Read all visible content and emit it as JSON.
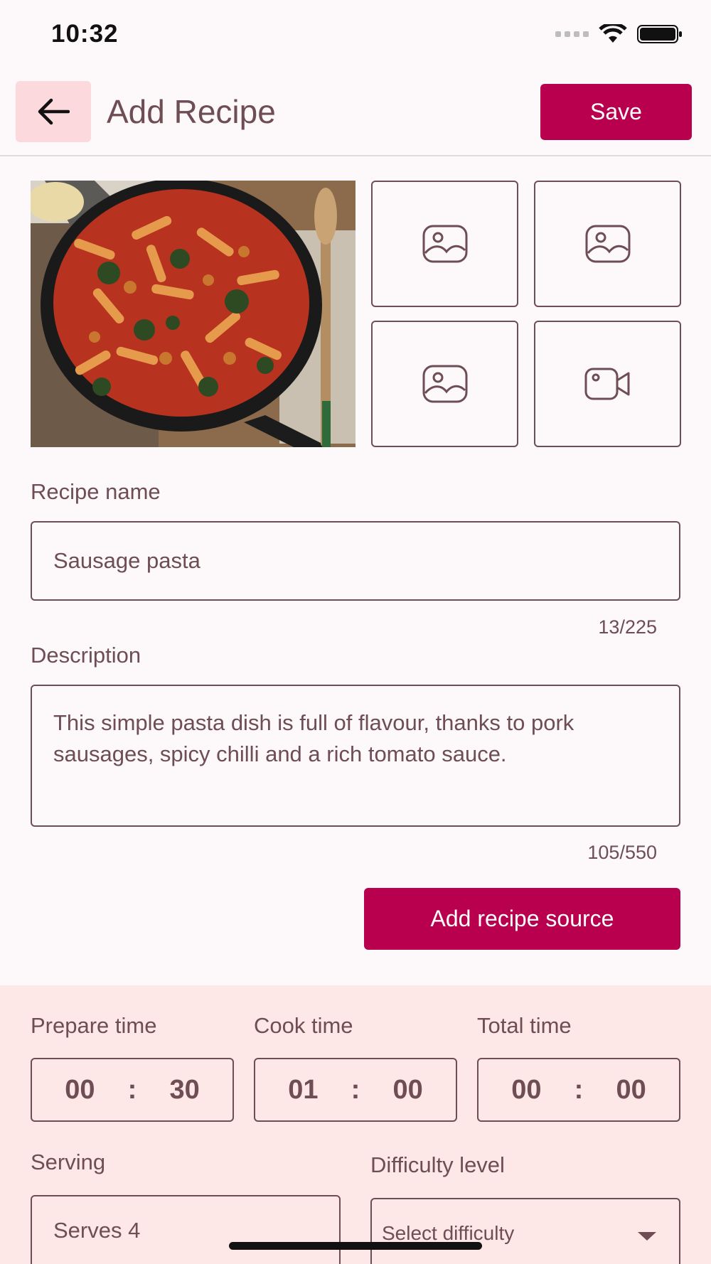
{
  "status_bar": {
    "time": "10:32",
    "icons": [
      "signal-icon",
      "wifi-icon",
      "battery-icon"
    ]
  },
  "app_bar": {
    "title": "Add Recipe",
    "save_label": "Save",
    "back_icon": "arrow-left-icon"
  },
  "media": {
    "main_photo_alt": "Sausage pasta in a cast-iron skillet",
    "slots": [
      {
        "icon": "image-icon"
      },
      {
        "icon": "image-icon"
      },
      {
        "icon": "image-icon"
      },
      {
        "icon": "video-camera-icon"
      }
    ]
  },
  "recipe_name": {
    "label": "Recipe name",
    "value": "Sausage pasta",
    "counter": "13/225"
  },
  "description": {
    "label": "Description",
    "value": "This simple pasta dish is full of flavour, thanks to pork sausages, spicy chilli and a rich tomato sauce.",
    "counter": "105/550"
  },
  "add_source_label": "Add recipe source",
  "times": {
    "prepare": {
      "label": "Prepare time",
      "hours": "00",
      "minutes": "30",
      "separator": ":"
    },
    "cook": {
      "label": "Cook time",
      "hours": "01",
      "minutes": "00",
      "separator": ":"
    },
    "total": {
      "label": "Total time",
      "hours": "00",
      "minutes": "00",
      "separator": ":"
    }
  },
  "serving": {
    "label": "Serving",
    "value": "Serves 4"
  },
  "difficulty": {
    "label": "Difficulty level",
    "placeholder": "Select difficulty"
  },
  "colors": {
    "accent": "#b8004f",
    "text": "#6e4d55",
    "back_button_bg": "#fcd9dd",
    "section_bg": "#fde7e7",
    "page_bg": "#fdf8fa"
  }
}
